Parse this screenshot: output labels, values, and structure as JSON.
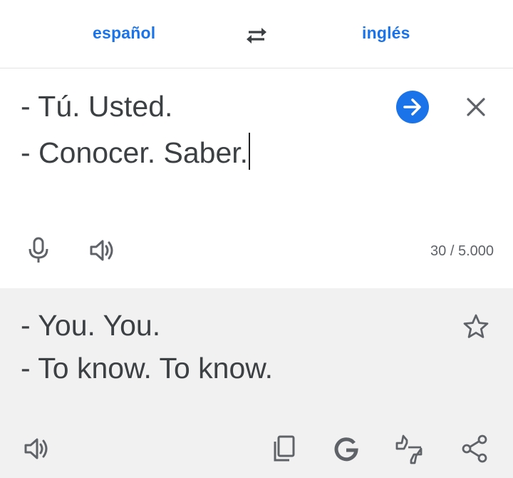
{
  "languages": {
    "source": "español",
    "target": "inglés"
  },
  "source": {
    "line1": "- Tú. Usted.",
    "line2": "- Conocer. Saber.",
    "char_count": "30 / 5.000"
  },
  "result": {
    "line1": "- You. You.",
    "line2": "- To know. To know."
  },
  "colors": {
    "accent": "#1a73e8",
    "icon": "#5f6368",
    "result_bg": "#f1f1f1"
  },
  "icons": [
    "swap-languages-icon",
    "arrow-right-icon",
    "close-icon",
    "microphone-icon",
    "speaker-icon",
    "star-icon",
    "copy-icon",
    "google-icon",
    "feedback-thumbs-icon",
    "share-icon"
  ]
}
